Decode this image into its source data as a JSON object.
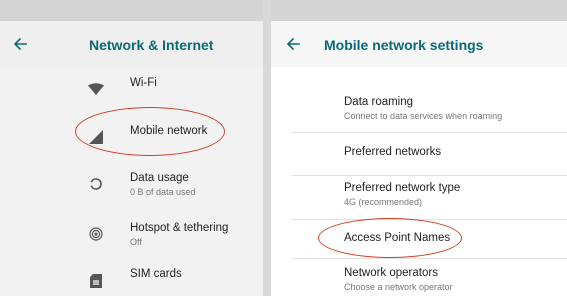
{
  "left": {
    "title": "Network & Internet",
    "items": [
      {
        "label": "Wi-Fi",
        "icon": "wifi-icon"
      },
      {
        "label": "Mobile network",
        "icon": "signal-icon"
      },
      {
        "label": "Data usage",
        "sublabel": "0 B of data used",
        "icon": "data-usage-icon"
      },
      {
        "label": "Hotspot & tethering",
        "sublabel": "Off",
        "icon": "hotspot-icon"
      },
      {
        "label": "SIM cards",
        "icon": "sim-card-icon"
      }
    ]
  },
  "right": {
    "title": "Mobile network settings",
    "rows": [
      {
        "label": "Data roaming",
        "sublabel": "Connect to data services when roaming"
      },
      {
        "label": "Preferred networks"
      },
      {
        "label": "Preferred network type",
        "sublabel": "4G (recommended)"
      },
      {
        "label": "Access Point Names"
      },
      {
        "label": "Network operators",
        "sublabel": "Choose a network operator"
      }
    ]
  },
  "colors": {
    "accent": "#0a6b78",
    "annotation": "#d0402b"
  }
}
